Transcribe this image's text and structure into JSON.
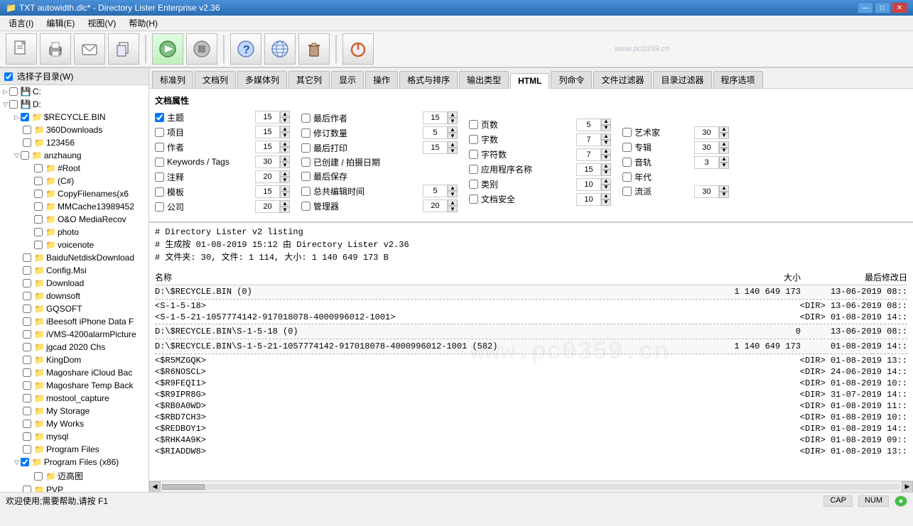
{
  "titlebar": {
    "title": "TXT autowidth.dlc* - Directory Lister Enterprise v2.36",
    "icon": "📁",
    "controls": [
      "—",
      "□",
      "✕"
    ]
  },
  "menubar": {
    "items": [
      "语言(I)",
      "编辑(E)",
      "视图(V)",
      "帮助(H)"
    ]
  },
  "toolbar": {
    "buttons": [
      {
        "icon": "📄",
        "name": "new"
      },
      {
        "icon": "🖨",
        "name": "print"
      },
      {
        "icon": "✉",
        "name": "email"
      },
      {
        "icon": "📋",
        "name": "copy"
      },
      {
        "icon": "▶",
        "name": "start"
      },
      {
        "icon": "⏹",
        "name": "stop"
      },
      {
        "icon": "❓",
        "name": "help"
      },
      {
        "icon": "🌐",
        "name": "web"
      },
      {
        "icon": "🗑",
        "name": "trash"
      },
      {
        "icon": "⏻",
        "name": "power"
      }
    ]
  },
  "sidebar": {
    "header": "选择子目录(W)",
    "items": [
      {
        "label": "C:",
        "level": 1,
        "type": "drive",
        "expanded": false,
        "checked": false
      },
      {
        "label": "D:",
        "level": 1,
        "type": "drive",
        "expanded": true,
        "checked": false
      },
      {
        "label": "$RECYCLE.BIN",
        "level": 2,
        "type": "folder",
        "expanded": false,
        "checked": true
      },
      {
        "label": "360Downloads",
        "level": 2,
        "type": "folder",
        "expanded": false,
        "checked": false
      },
      {
        "label": "123456",
        "level": 2,
        "type": "folder",
        "expanded": false,
        "checked": false
      },
      {
        "label": "anzhaung",
        "level": 2,
        "type": "folder",
        "expanded": true,
        "checked": false
      },
      {
        "label": "#Root",
        "level": 3,
        "type": "folder",
        "expanded": false,
        "checked": false
      },
      {
        "label": "(C#)",
        "level": 3,
        "type": "folder",
        "expanded": false,
        "checked": false
      },
      {
        "label": "CopyFilenames(x6",
        "level": 3,
        "type": "folder",
        "expanded": false,
        "checked": false
      },
      {
        "label": "MMCache13989452",
        "level": 3,
        "type": "folder",
        "expanded": false,
        "checked": false
      },
      {
        "label": "O&O MediaRecov",
        "level": 3,
        "type": "folder",
        "expanded": false,
        "checked": false
      },
      {
        "label": "photo",
        "level": 3,
        "type": "folder",
        "expanded": false,
        "checked": false
      },
      {
        "label": "voicenote",
        "level": 3,
        "type": "folder",
        "expanded": false,
        "checked": false
      },
      {
        "label": "BaiduNetdiskDownload",
        "level": 2,
        "type": "folder",
        "expanded": false,
        "checked": false
      },
      {
        "label": "Config.Msi",
        "level": 2,
        "type": "folder",
        "expanded": false,
        "checked": false
      },
      {
        "label": "Download",
        "level": 2,
        "type": "folder",
        "expanded": false,
        "checked": false
      },
      {
        "label": "downsoft",
        "level": 2,
        "type": "folder",
        "expanded": false,
        "checked": false
      },
      {
        "label": "GQSOFT",
        "level": 2,
        "type": "folder",
        "expanded": false,
        "checked": false
      },
      {
        "label": "iBeesoft iPhone Data F",
        "level": 2,
        "type": "folder",
        "expanded": false,
        "checked": false
      },
      {
        "label": "iVMS-4200alarmPicture",
        "level": 2,
        "type": "folder",
        "expanded": false,
        "checked": false
      },
      {
        "label": "jgcad 2020 Chs",
        "level": 2,
        "type": "folder",
        "expanded": false,
        "checked": false
      },
      {
        "label": "KingDom",
        "level": 2,
        "type": "folder",
        "expanded": false,
        "checked": false
      },
      {
        "label": "Magoshare iCloud Bac",
        "level": 2,
        "type": "folder",
        "expanded": false,
        "checked": false
      },
      {
        "label": "Magoshare Temp Back",
        "level": 2,
        "type": "folder",
        "expanded": false,
        "checked": false
      },
      {
        "label": "mostool_capture",
        "level": 2,
        "type": "folder",
        "expanded": false,
        "checked": false
      },
      {
        "label": "My Storage",
        "level": 2,
        "type": "folder",
        "expanded": false,
        "checked": false
      },
      {
        "label": "My Works",
        "level": 2,
        "type": "folder",
        "expanded": false,
        "checked": false
      },
      {
        "label": "mysql",
        "level": 2,
        "type": "folder",
        "expanded": false,
        "checked": false
      },
      {
        "label": "Program Files",
        "level": 2,
        "type": "folder",
        "expanded": false,
        "checked": false
      },
      {
        "label": "Program Files (x86)",
        "level": 2,
        "type": "folder",
        "expanded": true,
        "checked": true
      },
      {
        "label": "迈高图",
        "level": 3,
        "type": "folder",
        "expanded": false,
        "checked": false
      },
      {
        "label": "PVP",
        "level": 2,
        "type": "folder",
        "expanded": false,
        "checked": false
      }
    ]
  },
  "tabs": {
    "items": [
      "标准列",
      "文档列",
      "多媒体列",
      "其它列",
      "显示",
      "操作",
      "格式与排序",
      "输出类型",
      "HTML",
      "列命令",
      "文件过滤器",
      "目录过滤器",
      "程序选项"
    ],
    "active": "HTML"
  },
  "panel": {
    "section_title": "文档属性",
    "checkboxes": [
      {
        "label": "主题",
        "checked": true,
        "value": 15
      },
      {
        "label": "项目",
        "checked": false,
        "value": 15
      },
      {
        "label": "作者",
        "checked": false,
        "value": 15
      },
      {
        "label": "Keywords / Tags",
        "checked": false,
        "value": 30
      },
      {
        "label": "注释",
        "checked": false,
        "value": 20
      },
      {
        "label": "模板",
        "checked": false,
        "value": 15
      },
      {
        "label": "公司",
        "checked": false,
        "value": 20
      },
      {
        "label": "最后作者",
        "checked": false,
        "value": 15
      },
      {
        "label": "修订数量",
        "checked": false,
        "value": 5
      },
      {
        "label": "最后打印",
        "checked": false,
        "value": 15
      },
      {
        "label": "已创建 / 拍摄日期",
        "checked": false,
        "value": ""
      },
      {
        "label": "最后保存",
        "checked": false,
        "value": ""
      },
      {
        "label": "总共编辑时间",
        "checked": false,
        "value": 5
      },
      {
        "label": "管理器",
        "checked": false,
        "value": 20
      },
      {
        "label": "页数",
        "checked": false,
        "value": 5
      },
      {
        "label": "字数",
        "checked": false,
        "value": 7
      },
      {
        "label": "字符数",
        "checked": false,
        "value": 7
      },
      {
        "label": "应用程序名称",
        "checked": false,
        "value": 15
      },
      {
        "label": "类别",
        "checked": false,
        "value": 10
      },
      {
        "label": "文档安全",
        "checked": false,
        "value": 10
      },
      {
        "label": "艺术家",
        "checked": false,
        "value": 30
      },
      {
        "label": "专辑",
        "checked": false,
        "value": 30
      },
      {
        "label": "音轨",
        "checked": false,
        "value": 3
      },
      {
        "label": "年代",
        "checked": false,
        "value": ""
      },
      {
        "label": "流派",
        "checked": false,
        "value": 30
      }
    ]
  },
  "output": {
    "comment_lines": [
      "# Directory Lister v2 listing",
      "# 生成按 01-08-2019 15:12 由 Directory Lister v2.36",
      "# 文件夹: 30, 文件: 1 114, 大小: 1 140 649 173 B"
    ],
    "col_name": "名称",
    "col_size": "大小",
    "col_date": "最后修改日",
    "entries": [
      {
        "type": "header",
        "path": "D:\\$RECYCLE.BIN (0)",
        "size": "1 140 649 173",
        "date": "13-06-2019 08::"
      },
      {
        "type": "separator"
      },
      {
        "type": "item",
        "name": "<S-1-5-18>",
        "tag": "<DIR>",
        "date": "13-06-2019 08::"
      },
      {
        "type": "item",
        "name": "<S-1-5-21-1057774142-917018078-4000996012-1001>",
        "tag": "<DIR>",
        "date": "01-08-2019 14::"
      },
      {
        "type": "separator"
      },
      {
        "type": "header",
        "path": "D:\\$RECYCLE.BIN\\S-1-5-18 (0)",
        "size": "0",
        "date": "13-06-2019 08::"
      },
      {
        "type": "separator"
      },
      {
        "type": "header",
        "path": "D:\\$RECYCLE.BIN\\S-1-5-21-1057774142-917018078-4000996012-1001 (582)",
        "size": "1 140 649 173",
        "date": "01-08-2019 14::"
      },
      {
        "type": "separator"
      },
      {
        "type": "item",
        "name": "<$R5MZGQK>",
        "tag": "<DIR>",
        "date": "01-08-2019 13::"
      },
      {
        "type": "item",
        "name": "<$R6NOSCL>",
        "tag": "<DIR>",
        "date": "24-06-2019 14::"
      },
      {
        "type": "item",
        "name": "<$R9FEQI1>",
        "tag": "<DIR>",
        "date": "01-08-2019 10::"
      },
      {
        "type": "item",
        "name": "<$R9IPR8G>",
        "tag": "<DIR>",
        "date": "31-07-2019 14::"
      },
      {
        "type": "item",
        "name": "<$RB0A0WD>",
        "tag": "<DIR>",
        "date": "01-08-2019 11::"
      },
      {
        "type": "item",
        "name": "<$RBD7CH3>",
        "tag": "<DIR>",
        "date": "01-08-2019 10::"
      },
      {
        "type": "item",
        "name": "<$REDBOY1>",
        "tag": "<DIR>",
        "date": "01-08-2019 14::"
      },
      {
        "type": "item",
        "name": "<$RHK4A9K>",
        "tag": "<DIR>",
        "date": "01-08-2019 09::"
      },
      {
        "type": "item",
        "name": "<$RIADDW8>",
        "tag": "<DIR>",
        "date": "01-08-2019 13::"
      }
    ]
  },
  "statusbar": {
    "message": "欢迎使用;需要帮助,请按 F1",
    "indicators": [
      "CAP",
      "NUM"
    ]
  }
}
